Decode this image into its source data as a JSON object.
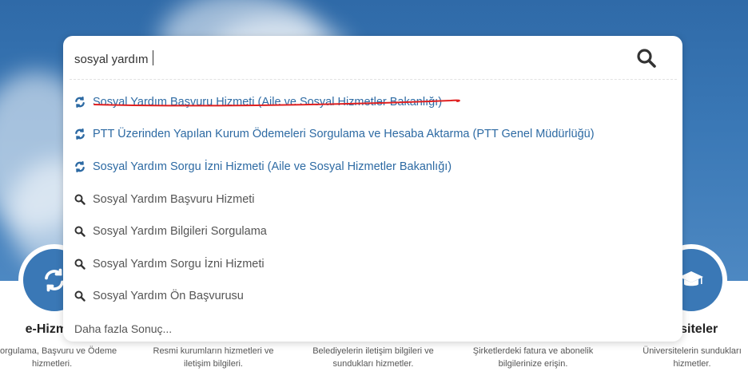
{
  "search": {
    "value": "sosyal yardım",
    "button_label": ""
  },
  "suggestions": [
    {
      "type": "service",
      "text": "Sosyal Yardım Başvuru Hizmeti (Aile ve Sosyal Hizmetler Bakanlığı)",
      "icon": "refresh-icon"
    },
    {
      "type": "service",
      "text": "PTT Üzerinden Yapılan Kurum Ödemeleri Sorgulama ve Hesaba Aktarma (PTT Genel Müdürlüğü)",
      "icon": "refresh-icon"
    },
    {
      "type": "service",
      "text": "Sosyal Yardım Sorgu İzni Hizmeti (Aile ve Sosyal Hizmetler Bakanlığı)",
      "icon": "refresh-icon"
    },
    {
      "type": "query",
      "text": "Sosyal Yardım Başvuru Hizmeti",
      "icon": "search-icon"
    },
    {
      "type": "query",
      "text": "Sosyal Yardım Bilgileri Sorgulama",
      "icon": "search-icon"
    },
    {
      "type": "query",
      "text": "Sosyal Yardım Sorgu İzni Hizmeti",
      "icon": "search-icon"
    },
    {
      "type": "query",
      "text": "Sosyal Yardım Ön Başvurusu",
      "icon": "search-icon"
    }
  ],
  "more_results": "Daha fazla Sonuç...",
  "cards": [
    {
      "title": "e-Hizme",
      "desc_line1": "orgulama, Başvuru ve Ödeme",
      "desc_line2": "hizmetleri.",
      "icon": "refresh-icon"
    },
    {
      "title": "",
      "desc_line1": "Resmi kurumların hizmetleri ve",
      "desc_line2": "iletişim bilgileri."
    },
    {
      "title": "",
      "desc_line1": "Belediyelerin iletişim bilgileri ve",
      "desc_line2": "sundukları hizmetler."
    },
    {
      "title": "",
      "desc_line1": "Şirketlerdeki fatura ve abonelik",
      "desc_line2": "bilgilerinize erişin."
    },
    {
      "title": "ersiteler",
      "desc_line1": "Üniversitelerin sundukları",
      "desc_line2": "hizmetler.",
      "icon": "graduation-cap-icon"
    }
  ],
  "colors": {
    "accent": "#3a78b6",
    "link": "#2d6aa3",
    "annotation": "#e02020"
  }
}
